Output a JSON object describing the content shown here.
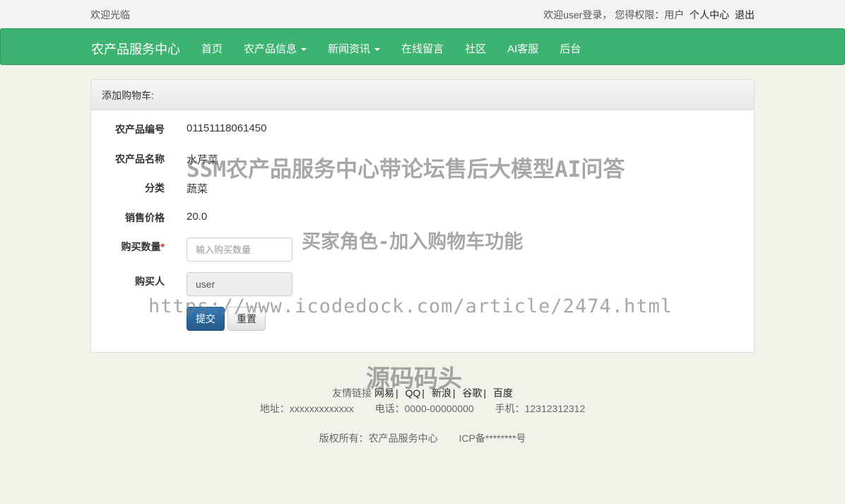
{
  "topbar": {
    "welcome": "欢迎光临",
    "user_info": "欢迎user登录， 您得权限：用户",
    "profile_link": "个人中心",
    "logout_link": "退出"
  },
  "navbar": {
    "brand": "农产品服务中心",
    "items": [
      {
        "label": "首页",
        "dropdown": false
      },
      {
        "label": "农产品信息",
        "dropdown": true
      },
      {
        "label": "新闻资讯",
        "dropdown": true
      },
      {
        "label": "在线留言",
        "dropdown": false
      },
      {
        "label": "社区",
        "dropdown": false
      },
      {
        "label": "AI客服",
        "dropdown": false
      },
      {
        "label": "后台",
        "dropdown": false
      }
    ]
  },
  "panel": {
    "heading": "添加购物车:",
    "fields": {
      "code_label": "农产品编号",
      "code_value": "01151118061450",
      "name_label": "农产品名称",
      "name_value": "水芹菜",
      "category_label": "分类",
      "category_value": "蔬菜",
      "price_label": "销售价格",
      "price_value": "20.0",
      "quantity_label": "购买数量",
      "quantity_required": "*",
      "quantity_placeholder": "输入购买数量",
      "buyer_label": "购买人",
      "buyer_value": "user"
    },
    "submit_label": "提交",
    "reset_label": "重置"
  },
  "footer": {
    "links_label": "友情链接",
    "links": [
      "网易",
      "QQ",
      "新浪",
      "谷歌",
      "百度"
    ],
    "separator": "|",
    "address": "地址：xxxxxxxxxxxxx",
    "phone": "电话：0000-00000000",
    "mobile": "手机：12312312312",
    "copyright": "版权所有：农产品服务中心",
    "icp": "ICP备********号"
  },
  "watermarks": {
    "title": "SSM农产品服务中心带论坛售后大模型AI问答",
    "feature": "买家角色-加入购物车功能",
    "url": "https://www.icodedock.com/article/2474.html",
    "brand": "源码码头"
  }
}
